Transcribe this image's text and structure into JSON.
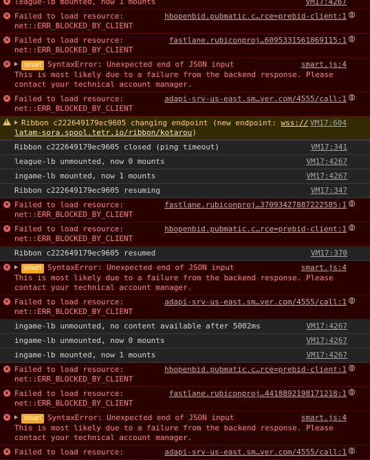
{
  "rows": [
    {
      "type": "error",
      "line1": "league-lb mounted, now 1 mounts",
      "source": "VM17:4267",
      "partial": true
    },
    {
      "type": "error",
      "line1": "Failed to load resource:",
      "line2": "net::ERR_BLOCKED_BY_CLIENT",
      "source": "hbopenbid.pubmatic.c…rce=prebid-client:1",
      "globe": true
    },
    {
      "type": "error",
      "line1": "Failed to load resource:",
      "line2": "net::ERR_BLOCKED_BY_CLIENT",
      "source": "fastlane.rubiconproj…6095331561869115:1",
      "globe": true
    },
    {
      "type": "error",
      "expandable": true,
      "badge": "smart",
      "line1": "SyntaxError: Unexpected end of JSON input",
      "line2": "This is most likely due to a failure from the backend response. Please",
      "line3": "contact your technical account manager.",
      "source": "smart.js:4"
    },
    {
      "type": "error",
      "line1": "Failed to load resource:",
      "line2": "net::ERR_BLOCKED_BY_CLIENT",
      "source": "adapi-srv-us-east.sm…ver.com/4555/call:1",
      "globe": true
    },
    {
      "type": "warning",
      "expandable": true,
      "line1": "Ribbon c222649179ec9605 changing endpoint (new endpoint: ",
      "line1_link": "wss://",
      "line2": "latam-sora.spool.tetr.io/ribbon/kotarou",
      "line2_suffix": ")",
      "source": "VM17:604"
    },
    {
      "type": "log",
      "line1": "Ribbon c222649179ec9605 closed (ping timeout)",
      "source": "VM17:341"
    },
    {
      "type": "log",
      "line1": "league-lb unmounted, now 0 mounts",
      "source": "VM17:4267"
    },
    {
      "type": "log",
      "line1": "ingame-lb mounted, now 1 mounts",
      "source": "VM17:4267"
    },
    {
      "type": "log",
      "line1": "Ribbon c222649179ec9605 resuming",
      "source": "VM17:347"
    },
    {
      "type": "error",
      "line1": "Failed to load resource:",
      "line2": "net::ERR_BLOCKED_BY_CLIENT",
      "source": "fastlane.rubiconproj…37093427887222585:1",
      "globe": true
    },
    {
      "type": "error",
      "line1": "Failed to load resource:",
      "line2": "net::ERR_BLOCKED_BY_CLIENT",
      "source": "hbopenbid.pubmatic.c…rce=prebid-client:1",
      "globe": true
    },
    {
      "type": "log",
      "line1": "Ribbon c222649179ec9605 resumed",
      "source": "VM17:370"
    },
    {
      "type": "error",
      "expandable": true,
      "badge": "smart",
      "line1": "SyntaxError: Unexpected end of JSON input",
      "line2": "This is most likely due to a failure from the backend response. Please",
      "line3": "contact your technical account manager.",
      "source": "smart.js:4"
    },
    {
      "type": "error",
      "line1": "Failed to load resource:",
      "line2": "net::ERR_BLOCKED_BY_CLIENT",
      "source": "adapi-srv-us-east.sm…ver.com/4555/call:1",
      "globe": true
    },
    {
      "type": "log",
      "line1": "ingame-lb unmounted, no content available after 5002ms",
      "source": "VM17:4267"
    },
    {
      "type": "log",
      "line1": "ingame-lb unmounted, now 0 mounts",
      "source": "VM17:4267"
    },
    {
      "type": "log",
      "line1": "ingame-lb mounted, now 1 mounts",
      "source": "VM17:4267"
    },
    {
      "type": "error",
      "line1": "Failed to load resource:",
      "line2": "net::ERR_BLOCKED_BY_CLIENT",
      "source": "hbopenbid.pubmatic.c…rce=prebid-client:1",
      "globe": true
    },
    {
      "type": "error",
      "line1": "Failed to load resource:",
      "line2": "net::ERR_BLOCKED_BY_CLIENT",
      "source": "fastlane.rubiconproj…4418892198171218:1",
      "globe": true
    },
    {
      "type": "error",
      "expandable": true,
      "badge": "smart",
      "line1": "SyntaxError: Unexpected end of JSON input",
      "line2": "This is most likely due to a failure from the backend response. Please",
      "line3": "contact your technical account manager.",
      "source": "smart.js:4"
    },
    {
      "type": "error",
      "line1": "Failed to load resource:",
      "source": "adapi-srv-us-east.sm…ver.com/4555/call:1",
      "globe": true
    }
  ]
}
